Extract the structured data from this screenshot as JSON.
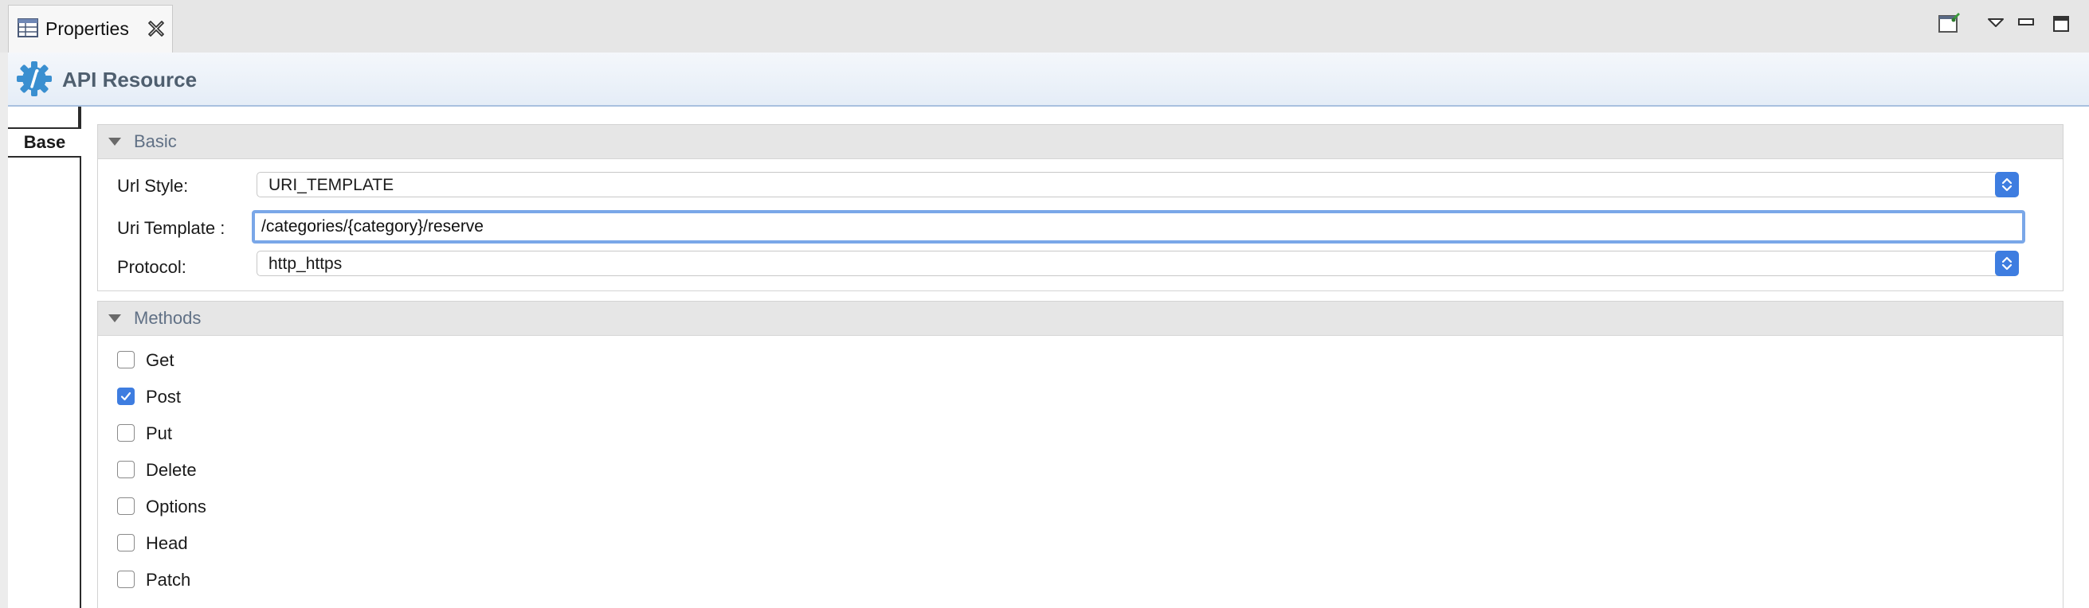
{
  "tab": {
    "title": "Properties"
  },
  "header": {
    "title": "API Resource"
  },
  "side_tabs": [
    {
      "label": "Base"
    }
  ],
  "basic": {
    "title": "Basic",
    "url_style": {
      "label": "Url Style:",
      "value": "URI_TEMPLATE"
    },
    "uri_template": {
      "label": "Uri Template :",
      "value": "/categories/{category}/reserve"
    },
    "protocol": {
      "label": "Protocol:",
      "value": "http_https"
    }
  },
  "methods": {
    "title": "Methods",
    "items": [
      {
        "label": "Get",
        "checked": false
      },
      {
        "label": "Post",
        "checked": true
      },
      {
        "label": "Put",
        "checked": false
      },
      {
        "label": "Delete",
        "checked": false
      },
      {
        "label": "Options",
        "checked": false
      },
      {
        "label": "Head",
        "checked": false
      },
      {
        "label": "Patch",
        "checked": false
      }
    ]
  },
  "colors": {
    "accent": "#3e7de0",
    "header_text": "#4f5f6f",
    "section_title": "#607085"
  },
  "icons": {
    "tab": "table-icon",
    "close": "close-icon",
    "header": "api-gear-icon",
    "toolbar": [
      "pin-view-icon",
      "view-menu-icon",
      "minimize-icon",
      "maximize-icon"
    ]
  }
}
